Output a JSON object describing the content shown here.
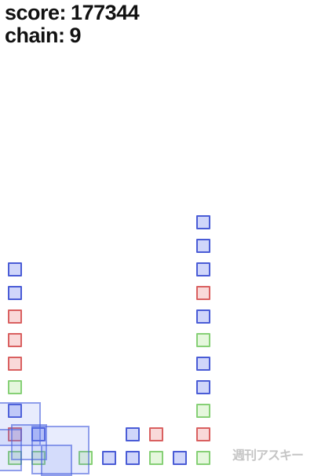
{
  "hud": {
    "score_label": "score:",
    "score_value": "177344",
    "chain_label": "chain:",
    "chain_value": "9"
  },
  "colors": {
    "blue": "#4a5cd6",
    "red": "#d96060",
    "green": "#86d076"
  },
  "stacks": [
    {
      "column": 1,
      "blocks": [
        "green",
        "red",
        "blue",
        "green",
        "red",
        "red",
        "red",
        "blue",
        "blue"
      ]
    },
    {
      "column": 2,
      "blocks": [
        "green",
        "blue"
      ]
    },
    {
      "column": 4,
      "blocks": [
        "green"
      ]
    },
    {
      "column": 5,
      "blocks": [
        "blue"
      ]
    },
    {
      "column": 6,
      "blocks": [
        "blue",
        "blue"
      ]
    },
    {
      "column": 7,
      "blocks": [
        "green",
        "red"
      ]
    },
    {
      "column": 8,
      "blocks": [
        "blue"
      ]
    },
    {
      "column": 9,
      "blocks": [
        "green",
        "red",
        "green",
        "blue",
        "blue",
        "green",
        "blue",
        "red",
        "blue",
        "blue",
        "blue"
      ]
    }
  ],
  "watermark": "週刊アスキー"
}
